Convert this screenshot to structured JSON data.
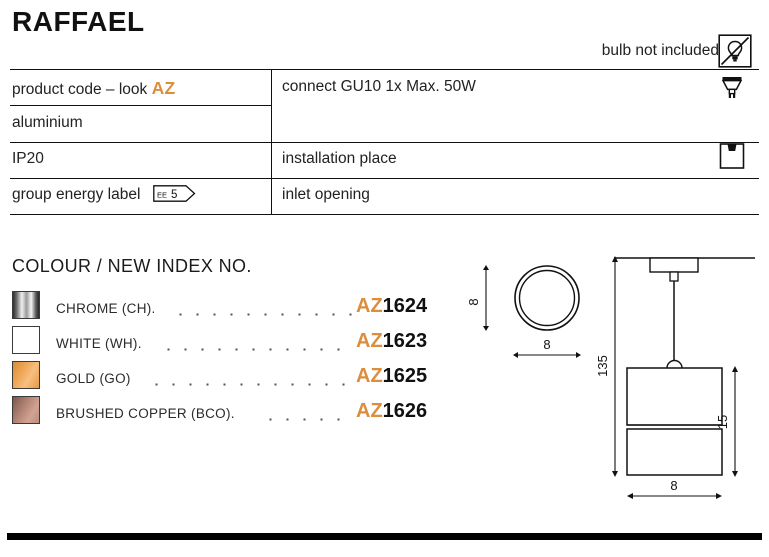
{
  "product": {
    "title": "RAFFAEL",
    "bulb_note": "bulb not included",
    "bulb_note_icon": "no-bulb-icon"
  },
  "spec_table": {
    "rows": [
      {
        "left_label": "product code – look",
        "left_accent": "AZ",
        "right_label": "connect GU10 1x Max. 50W",
        "right_icon": "gu10-bulb-icon"
      },
      {
        "left_label": "aluminium",
        "left_accent": "",
        "right_label": "",
        "right_icon": ""
      },
      {
        "left_label": "IP20",
        "left_accent": "",
        "right_label": "installation place",
        "right_icon": "ceiling-mount-icon"
      },
      {
        "left_label": "group energy label",
        "left_accent": "",
        "badge": {
          "prefix": "EE",
          "value": "5"
        },
        "right_label": "inlet opening",
        "right_icon": ""
      }
    ]
  },
  "colour_section": {
    "heading": "COLOUR / NEW INDEX NO.",
    "items": [
      {
        "name": "CHROME (CH).",
        "swatch": "chrome",
        "code_prefix": "AZ",
        "code_number": "1624"
      },
      {
        "name": "WHITE (WH).",
        "swatch": "white",
        "code_prefix": "AZ",
        "code_number": "1623"
      },
      {
        "name": "GOLD (GO)",
        "swatch": "gold",
        "code_prefix": "AZ",
        "code_number": "1625"
      },
      {
        "name": "BRUSHED COPPER (BCO).",
        "swatch": "copper",
        "code_prefix": "AZ",
        "code_number": "1626"
      }
    ]
  },
  "drawings": {
    "top_view": {
      "label": "top-view-circle",
      "dim_vertical": "8",
      "dim_horizontal": "8"
    },
    "side_view": {
      "label": "side-view-pendant",
      "dim_total_height": "135",
      "dim_shade_height": "15",
      "dim_width": "8"
    }
  },
  "colors": {
    "accent_orange": "#DD8E3D",
    "line_black": "#111111",
    "text": "#222222"
  }
}
